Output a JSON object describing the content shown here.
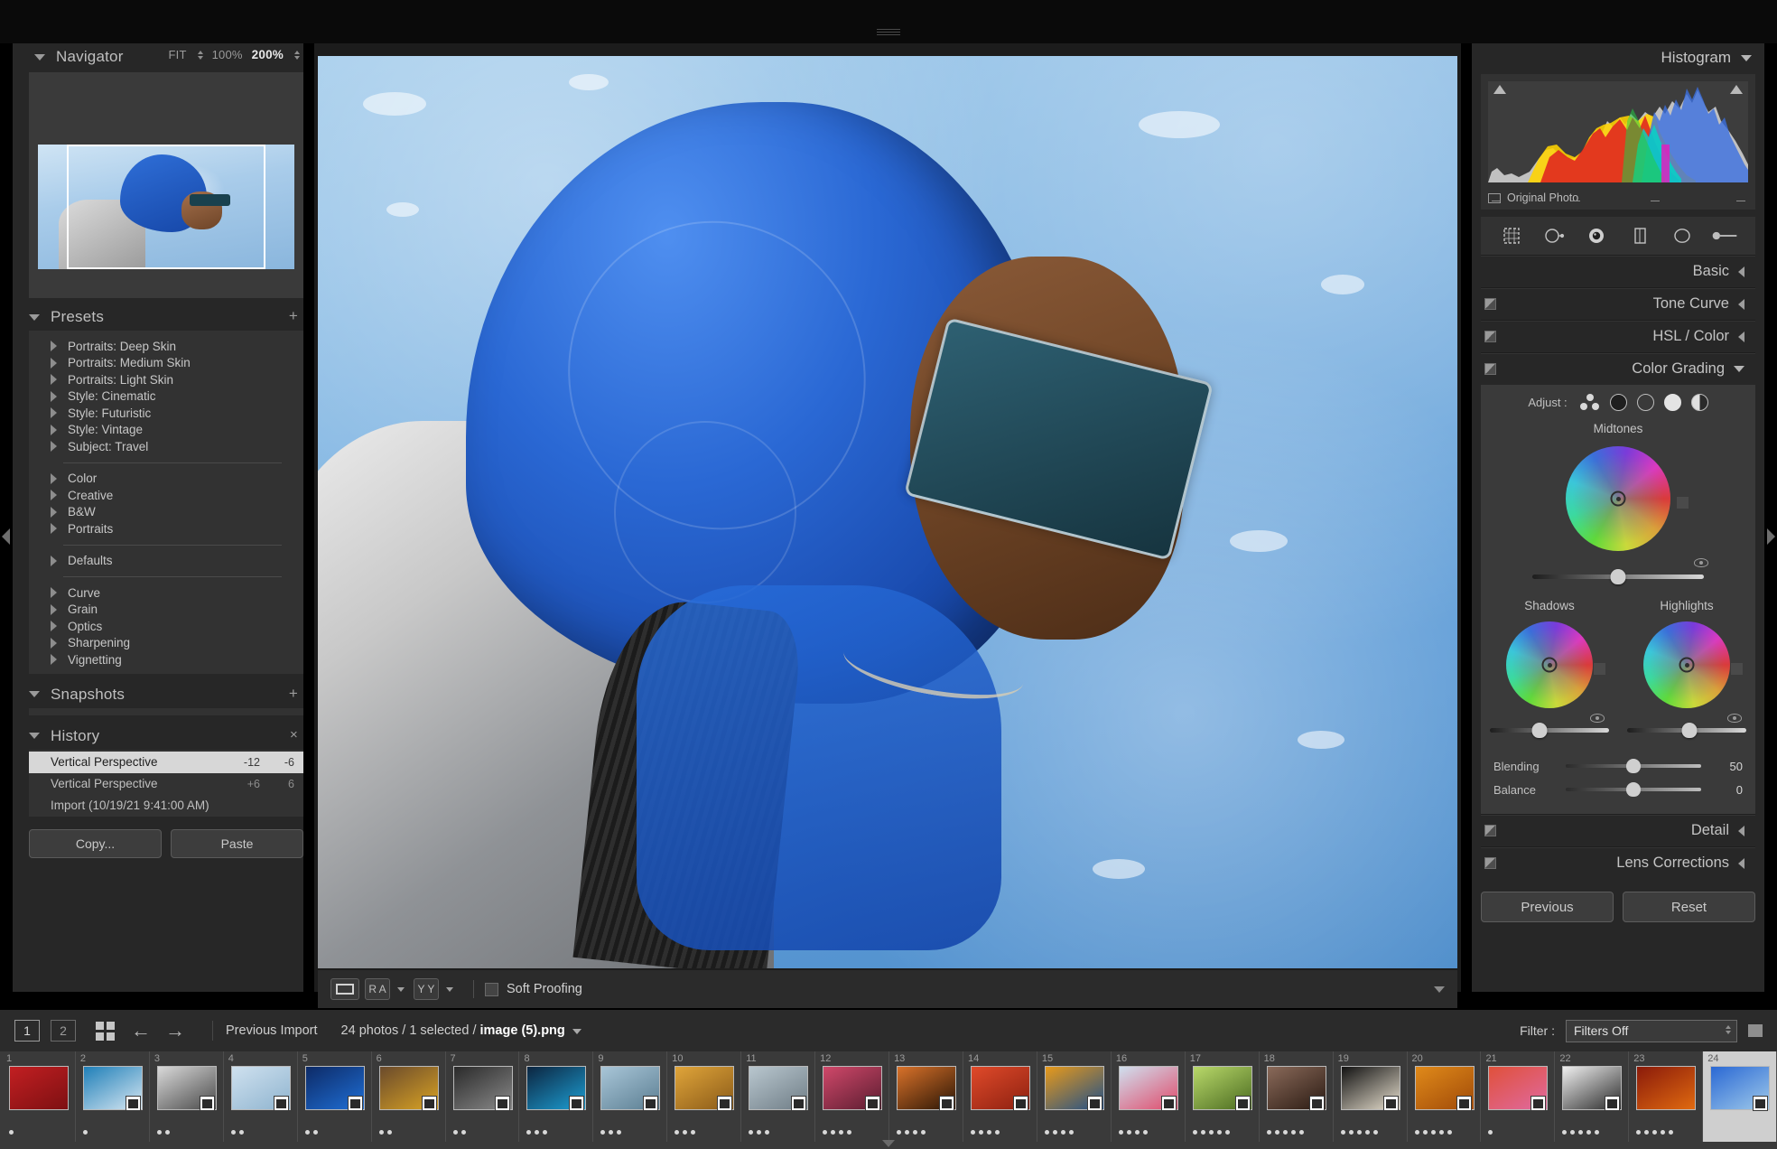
{
  "navigator": {
    "title": "Navigator",
    "zoom_options": [
      {
        "label": "FIT",
        "selected": false,
        "stepper": true
      },
      {
        "label": "100%",
        "selected": false,
        "stepper": false
      },
      {
        "label": "200%",
        "selected": true,
        "stepper": true
      }
    ]
  },
  "presets": {
    "title": "Presets",
    "add_label": "+",
    "groups": [
      {
        "items": [
          "Portraits: Deep Skin",
          "Portraits: Medium Skin",
          "Portraits: Light Skin",
          "Style: Cinematic",
          "Style: Futuristic",
          "Style: Vintage",
          "Subject: Travel"
        ]
      },
      {
        "items": [
          "Color",
          "Creative",
          "B&W",
          "Portraits"
        ]
      },
      {
        "items": [
          "Defaults"
        ]
      },
      {
        "items": [
          "Curve",
          "Grain",
          "Optics",
          "Sharpening",
          "Vignetting"
        ]
      }
    ]
  },
  "snapshots": {
    "title": "Snapshots",
    "add_label": "+"
  },
  "history": {
    "title": "History",
    "close_label": "×",
    "rows": [
      {
        "name": "Vertical Perspective",
        "value1": "-12",
        "value2": "-6",
        "selected": true
      },
      {
        "name": "Vertical Perspective",
        "value1": "+6",
        "value2": "6",
        "selected": false
      },
      {
        "name": "Import (10/19/21 9:41:00 AM)",
        "value1": "",
        "value2": "",
        "selected": false
      }
    ]
  },
  "left_buttons": {
    "copy": "Copy...",
    "paste": "Paste"
  },
  "toolbar": {
    "loupe_icon": "loupe-view-icon",
    "compare_label": "R A",
    "survey_label": "Y Y",
    "soft_proofing_label": "Soft Proofing",
    "soft_proofing_checked": false
  },
  "right": {
    "histogram": {
      "title": "Histogram",
      "original_photo_label": "Original Photo"
    },
    "tools": [
      "crop-overlay-icon",
      "spot-removal-icon",
      "red-eye-correction-icon",
      "masking-icon",
      "radial-filter-icon",
      "adjustment-brush-icon"
    ],
    "sections": [
      {
        "title": "Basic",
        "state": "collapsed"
      },
      {
        "title": "Tone Curve",
        "state": "collapsed"
      },
      {
        "title": "HSL / Color",
        "state": "collapsed"
      },
      {
        "title": "Color Grading",
        "state": "expanded"
      }
    ],
    "sections_bottom": [
      {
        "title": "Detail",
        "state": "collapsed"
      },
      {
        "title": "Lens Corrections",
        "state": "collapsed"
      }
    ],
    "color_grading": {
      "adjust_label": "Adjust :",
      "modes": [
        "three-way-mode",
        "shadows-mode",
        "midtones-mode",
        "highlights-mode",
        "global-mode"
      ],
      "selected_mode_index": 3,
      "wheels": [
        {
          "name": "Midtones",
          "luminance": 50
        },
        {
          "name": "Shadows",
          "luminance": 42
        },
        {
          "name": "Highlights",
          "luminance": 52
        }
      ],
      "sliders": [
        {
          "label": "Blending",
          "value": "50",
          "pct": 50
        },
        {
          "label": "Balance",
          "value": "0",
          "pct": 50
        }
      ]
    },
    "buttons": {
      "previous": "Previous",
      "reset": "Reset"
    }
  },
  "filmstrip_bar": {
    "screen1": "1",
    "screen2": "2",
    "grid_icon": "grid-view-icon",
    "back_icon": "←",
    "forward_icon": "→",
    "source": "Previous Import",
    "count_prefix": "24 photos / 1 selected / ",
    "filename": "image (5).png",
    "filter_label": "Filter :",
    "filter_value": "Filters Off"
  },
  "filmstrip": {
    "thumbs": [
      {
        "n": "1",
        "stars": 1,
        "badge": false,
        "c1": "#c21f22",
        "c2": "#7d1012",
        "sel": false
      },
      {
        "n": "2",
        "stars": 1,
        "badge": true,
        "c1": "#1f7fb8",
        "c2": "#d7e7f2",
        "sel": false
      },
      {
        "n": "3",
        "stars": 2,
        "badge": true,
        "c1": "#d9d9d9",
        "c2": "#4a4a4a",
        "sel": false
      },
      {
        "n": "4",
        "stars": 2,
        "badge": true,
        "c1": "#cfe1ef",
        "c2": "#8fb4cf",
        "sel": false
      },
      {
        "n": "5",
        "stars": 2,
        "badge": true,
        "c1": "#0d2a66",
        "c2": "#1f6fd6",
        "sel": false
      },
      {
        "n": "6",
        "stars": 2,
        "badge": true,
        "c1": "#6a4a2c",
        "c2": "#d9a324",
        "sel": false
      },
      {
        "n": "7",
        "stars": 2,
        "badge": true,
        "c1": "#2a2a2a",
        "c2": "#8a8a8a",
        "sel": false
      },
      {
        "n": "8",
        "stars": 3,
        "badge": true,
        "c1": "#0c2540",
        "c2": "#1d9fd4",
        "sel": false
      },
      {
        "n": "9",
        "stars": 3,
        "badge": true,
        "c1": "#a9c6d8",
        "c2": "#5b7e92",
        "sel": false
      },
      {
        "n": "10",
        "stars": 3,
        "badge": true,
        "c1": "#e0a53a",
        "c2": "#8a5a18",
        "sel": false
      },
      {
        "n": "11",
        "stars": 3,
        "badge": true,
        "c1": "#b9c7cf",
        "c2": "#6f7d86",
        "sel": false
      },
      {
        "n": "12",
        "stars": 4,
        "badge": true,
        "c1": "#d0486a",
        "c2": "#5a1d30",
        "sel": false
      },
      {
        "n": "13",
        "stars": 4,
        "badge": true,
        "c1": "#d9722a",
        "c2": "#2a1505",
        "sel": false
      },
      {
        "n": "14",
        "stars": 4,
        "badge": true,
        "c1": "#e04a2a",
        "c2": "#8c2010",
        "sel": false
      },
      {
        "n": "15",
        "stars": 4,
        "badge": true,
        "c1": "#e89a1a",
        "c2": "#1f4f8a",
        "sel": false
      },
      {
        "n": "16",
        "stars": 4,
        "badge": true,
        "c1": "#cfe0ef",
        "c2": "#e04a6a",
        "sel": false
      },
      {
        "n": "17",
        "stars": 5,
        "badge": true,
        "c1": "#b9d96a",
        "c2": "#4a6a20",
        "sel": false
      },
      {
        "n": "18",
        "stars": 5,
        "badge": true,
        "c1": "#8a6a5a",
        "c2": "#2a1a12",
        "sel": false
      },
      {
        "n": "19",
        "stars": 5,
        "badge": true,
        "c1": "#121212",
        "c2": "#e8e0cf",
        "sel": false
      },
      {
        "n": "20",
        "stars": 5,
        "badge": true,
        "c1": "#e08a1a",
        "c2": "#a04a08",
        "sel": false
      },
      {
        "n": "21",
        "stars": 1,
        "badge": true,
        "c1": "#e0503a",
        "c2": "#e06aa0",
        "sel": false
      },
      {
        "n": "22",
        "stars": 5,
        "badge": true,
        "c1": "#f0f0f0",
        "c2": "#2a2a2a",
        "sel": false
      },
      {
        "n": "23",
        "stars": 5,
        "badge": false,
        "c1": "#8a1a0a",
        "c2": "#e06a10",
        "sel": false
      },
      {
        "n": "24",
        "stars": 0,
        "badge": true,
        "c1": "#2a68d4",
        "c2": "#9ec9ea",
        "sel": true
      }
    ]
  }
}
